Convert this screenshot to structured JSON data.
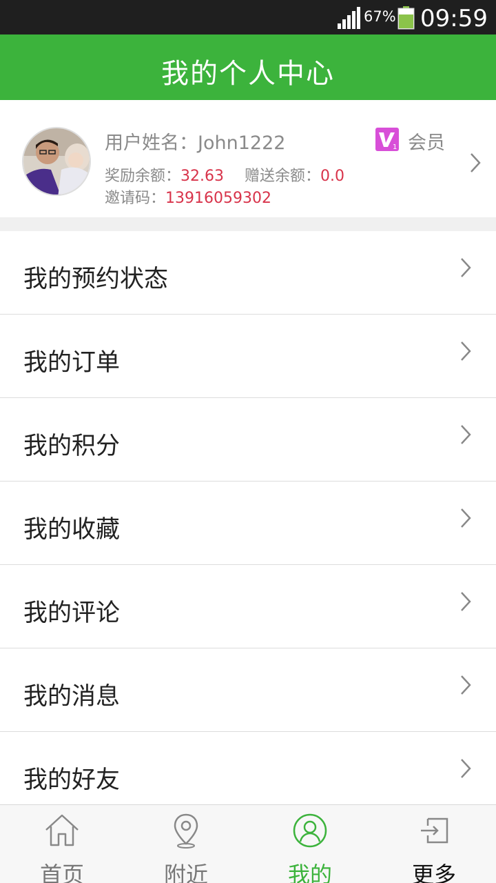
{
  "status_bar": {
    "battery_percent": "67%",
    "time": "09:59"
  },
  "header": {
    "title": "我的个人中心"
  },
  "profile": {
    "username_label": "用户姓名：",
    "username": "John1222",
    "member_label": "会员",
    "reward_label": "奖励余额：",
    "reward_value": "32.63",
    "gift_label": "赠送余额：",
    "gift_value": "0.0",
    "invite_label": "邀请码：",
    "invite_code": "13916059302"
  },
  "menu": {
    "items": [
      {
        "label": "我的预约状态"
      },
      {
        "label": "我的订单"
      },
      {
        "label": "我的积分"
      },
      {
        "label": "我的收藏"
      },
      {
        "label": "我的评论"
      },
      {
        "label": "我的消息"
      },
      {
        "label": "我的好友"
      }
    ]
  },
  "tab_bar": {
    "tabs": [
      {
        "label": "首页",
        "icon": "home-icon"
      },
      {
        "label": "附近",
        "icon": "location-pin-icon"
      },
      {
        "label": "我的",
        "icon": "user-circle-icon",
        "active": true
      },
      {
        "label": "更多",
        "icon": "login-icon"
      }
    ]
  },
  "colors": {
    "brand_green": "#3cb33c",
    "accent_red": "#d8334a"
  }
}
